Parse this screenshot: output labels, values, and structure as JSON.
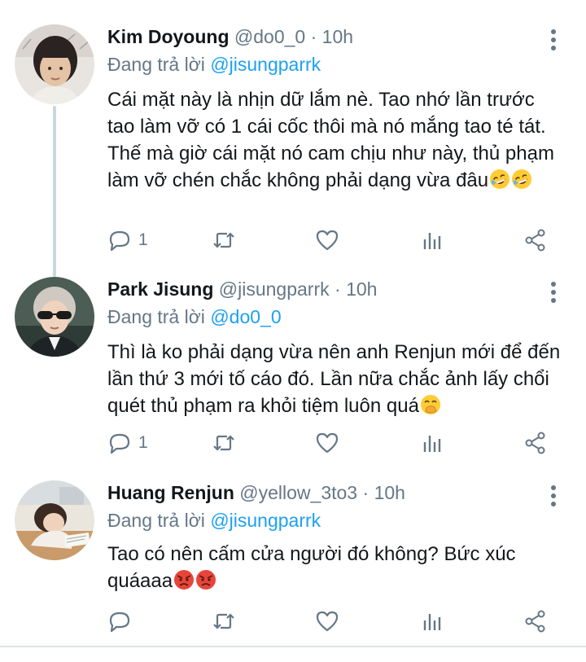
{
  "tweets": [
    {
      "name": "Kim Doyoung",
      "handle": "@do0_0",
      "separator": "·",
      "time": "10h",
      "reply_prefix": "Đang trả lời",
      "reply_to": "@jisungparrk",
      "text": "Cái mặt này là nhịn dữ lắm nè. Tao nhớ lần trước tao làm vỡ có 1 cái cốc thôi mà nó mắng tao té tát. Thế mà giờ cái mặt nó cam chịu như này, thủ phạm làm vỡ chén chắc không phải dạng vừa đâu",
      "emoji": [
        "rofl-emoji",
        "rofl-emoji"
      ],
      "reply_count": "1"
    },
    {
      "name": "Park Jisung",
      "handle": "@jisungparrk",
      "separator": "·",
      "time": "10h",
      "reply_prefix": "Đang trả lời",
      "reply_to": "@do0_0",
      "text": "Thì là ko phải dạng vừa nên anh Renjun mới để đến lần thứ 3 mới tố cáo đó. Lần nữa chắc ảnh lấy chổi quét thủ phạm ra khỏi tiệm luôn quá",
      "emoji": [
        "hand-over-mouth-emoji"
      ],
      "reply_count": "1"
    },
    {
      "name": "Huang Renjun",
      "handle": "@yellow_3to3",
      "separator": "·",
      "time": "10h",
      "reply_prefix": "Đang trả lời",
      "reply_to": "@jisungparrk",
      "text": "Tao có nên cấm cửa người đó không? Bức xúc quáaaa",
      "emoji": [
        "angry-face-emoji",
        "angry-face-emoji"
      ],
      "reply_count": ""
    }
  ],
  "colors": {
    "accent": "#1da1f2",
    "secondary_text": "#657786",
    "primary_text": "#14171a",
    "thread_line": "#ccd6dd"
  },
  "icons": [
    "reply-icon",
    "retweet-icon",
    "like-icon",
    "analytics-icon",
    "share-icon",
    "more-icon"
  ]
}
